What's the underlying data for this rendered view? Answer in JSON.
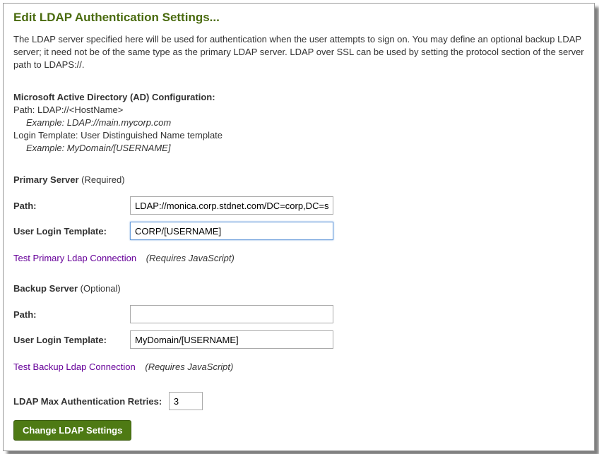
{
  "title": "Edit LDAP Authentication Settings...",
  "intro": "The LDAP server specified here will be used for authentication when the user attempts to sign on. You may define an optional backup LDAP server; it need not be of the same type as the primary LDAP server. LDAP over SSL can be used by setting the protocol section of the server path to LDAPS://.",
  "ad_config": {
    "heading": "Microsoft Active Directory (AD) Configuration:",
    "path_line": "Path: LDAP://<HostName>",
    "path_example": "Example: LDAP://main.mycorp.com",
    "login_line": "Login Template: User Distinguished Name template",
    "login_example": "Example: MyDomain/[USERNAME]"
  },
  "primary": {
    "heading": "Primary Server",
    "req_note": " (Required)",
    "path_label": "Path:",
    "path_value": "LDAP://monica.corp.stdnet.com/DC=corp,DC=stdn",
    "login_label": "User Login Template:",
    "login_value": "CORP/[USERNAME]",
    "test_link": "Test Primary Ldap Connection",
    "js_note": "(Requires JavaScript)"
  },
  "backup": {
    "heading": "Backup Server",
    "req_note": " (Optional)",
    "path_label": "Path:",
    "path_value": "",
    "login_label": "User Login Template:",
    "login_value": "MyDomain/[USERNAME]",
    "test_link": "Test Backup Ldap Connection",
    "js_note": "(Requires JavaScript)"
  },
  "retries": {
    "label": "LDAP Max Authentication Retries:",
    "value": "3"
  },
  "submit_label": "Change LDAP Settings"
}
